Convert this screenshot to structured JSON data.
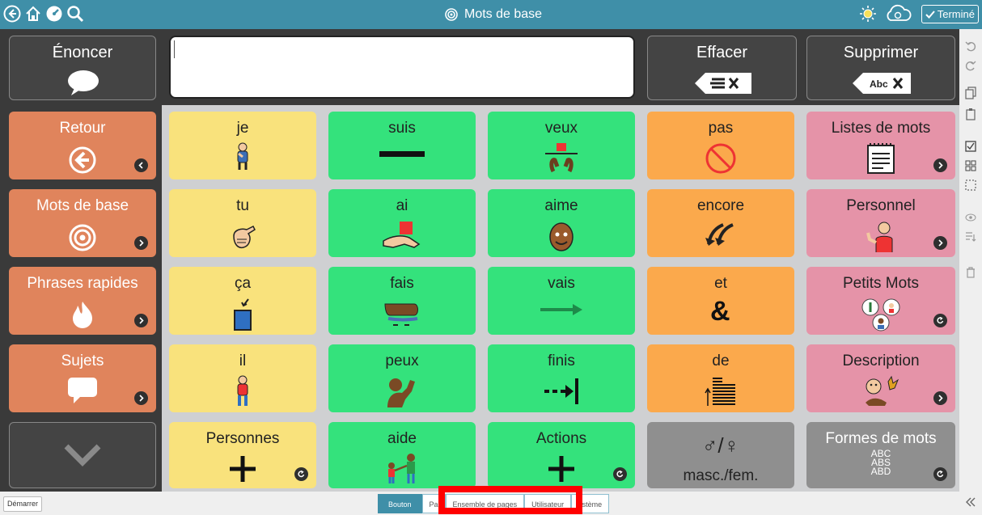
{
  "header": {
    "title": "Mots de base",
    "done_label": "Terminé",
    "icons": [
      "back-icon",
      "home-icon",
      "speed-icon",
      "search-icon",
      "brightness-icon",
      "sync-cloud-icon"
    ]
  },
  "top": {
    "speak_label": "Énoncer",
    "clear_label": "Effacer",
    "clear_badge": "x",
    "delete_label": "Supprimer",
    "delete_badge": "Abc X",
    "message_text": ""
  },
  "sidebar": [
    {
      "label": "Retour",
      "icon": "arrow-left-circle-icon"
    },
    {
      "label": "Mots de base",
      "icon": "target-icon"
    },
    {
      "label": "Phrases rapides",
      "icon": "fire-icon"
    },
    {
      "label": "Sujets",
      "icon": "speech-bubble-icon"
    },
    {
      "label": "",
      "icon": "chevron-down-icon"
    }
  ],
  "grid": [
    [
      "je",
      "suis",
      "veux",
      "pas",
      "Listes de mots"
    ],
    [
      "tu",
      "ai",
      "aime",
      "encore",
      "Personnel"
    ],
    [
      "ça",
      "fais",
      "vais",
      "et",
      "Petits Mots"
    ],
    [
      "il",
      "peux",
      "finis",
      "de",
      "Description"
    ],
    [
      "Personnes",
      "aide",
      "Actions",
      "♂/♀",
      "Formes de mots"
    ]
  ],
  "grid_extra": {
    "masc_fem_sub": "masc./fem.",
    "forms_glyph": [
      "ABC",
      "ABS",
      "ABD"
    ]
  },
  "bottom": {
    "start_label": "Démarrer",
    "tabs": [
      "Bouton",
      "Pa",
      "Ensemble de pages",
      "Utilisateur",
      "ystème"
    ]
  },
  "colors": {
    "topbar": "#3f8fa8",
    "yellow": "#f9e27c",
    "green": "#34e27c",
    "orange": "#fba94c",
    "pink": "#e593a8",
    "salmon": "#e0845c",
    "gray": "#8f8f8f",
    "highlight": "#ff0000"
  }
}
